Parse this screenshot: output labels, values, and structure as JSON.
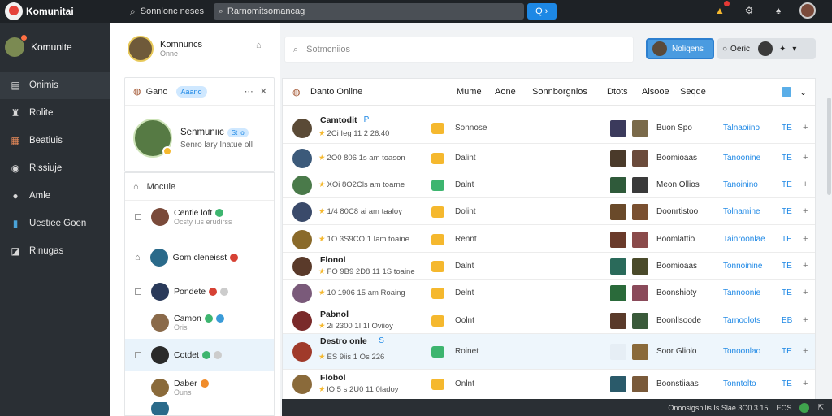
{
  "topbar": {
    "logo_text": "Komunitai",
    "search_label": "Sonnlonc neses",
    "search_value": "Rarnomitsomancag",
    "search_button": "Q ›"
  },
  "sidebar": {
    "brand": "Komunite",
    "items": [
      {
        "label": "Onimis",
        "icon": "grid-icon"
      },
      {
        "label": "Rolite",
        "icon": "people-icon"
      },
      {
        "label": "Beatiuis",
        "icon": "cards-icon"
      },
      {
        "label": "Rissiuje",
        "icon": "target-icon"
      },
      {
        "label": "Amle",
        "icon": "chat-icon"
      },
      {
        "label": "Uestiee Goen",
        "icon": "phone-icon"
      },
      {
        "label": "Rinugas",
        "icon": "square-icon"
      }
    ]
  },
  "left_panel": {
    "user_name": "Komnuncs",
    "user_sub": "Onne",
    "card": {
      "title": "Gano",
      "tag": "Aaano",
      "name": "Senmuniic",
      "pill": "St lo",
      "status": "Senro lary Inatue oll"
    },
    "friends_title": "Mocule",
    "friends": [
      {
        "name": "Centie loft",
        "sub": "Ocsty ius erudirss",
        "color": "#3db56f"
      },
      {
        "name": "Gom cleneisst",
        "sub": "",
        "color": "#d64134"
      },
      {
        "name": "Pondete",
        "sub": "",
        "color": "#d64134"
      },
      {
        "name": "Camon",
        "sub": "Oris",
        "color": "#3a9bd8"
      },
      {
        "name": "Cotdet",
        "sub": "",
        "color": "#3db56f"
      },
      {
        "name": "Daber",
        "sub": "Ouns",
        "color": "#f08c2b"
      }
    ]
  },
  "main": {
    "search_placeholder": "Sotmcniios",
    "blue_button": "Noliqens",
    "grey_button": "Oeric",
    "header": {
      "title": "Danto Online",
      "col1": "Mume",
      "col2": "Aone",
      "col3": "Sonnborgnios",
      "col4": "Dtots",
      "col5": "Alsooe",
      "col6": "Seqqe"
    },
    "rows": [
      {
        "name": "Camtodit",
        "badge": "P",
        "meta": "2Ci Ieg 11 2 26:40",
        "icon_color": "#f5b82e",
        "status": "Sonnose",
        "game": "Buon Spo",
        "link": "Talnaoiino",
        "te": "TE",
        "av": "#5a4a36",
        "th1": "#3b3a5c",
        "th2": "#7a6a4a"
      },
      {
        "name": "",
        "badge": "",
        "meta": "2O0 806 1s am toason",
        "icon_color": "#f5b82e",
        "status": "Dalint",
        "game": "Boomioaas",
        "link": "Tanoonine",
        "te": "TE",
        "av": "#3c5a7a",
        "th1": "#4a3a2a",
        "th2": "#6b4b3b"
      },
      {
        "name": "",
        "badge": "",
        "meta": "XOi 8O2Cls am toarne",
        "icon_color": "#3db56f",
        "status": "Dalnt",
        "game": "Meon Ollios",
        "link": "Tanoinino",
        "te": "TE",
        "av": "#4a7a4a",
        "th1": "#2f5a3a",
        "th2": "#3a3a3a"
      },
      {
        "name": "",
        "badge": "",
        "meta": "1/4 80C8 ai am taaloy",
        "icon_color": "#f5b82e",
        "status": "Dolint",
        "game": "Doonrtistoo",
        "link": "Tolnamine",
        "te": "TE",
        "av": "#3a4a6a",
        "th1": "#6a4a2a",
        "th2": "#7a5030"
      },
      {
        "name": "",
        "badge": "",
        "meta": "1O 3S9CO 1 Iam toaine",
        "icon_color": "#f5b82e",
        "status": "Rennt",
        "game": "Boomlattio",
        "link": "Tainroonlae",
        "te": "TE",
        "av": "#8a6a2a",
        "th1": "#6a3a2a",
        "th2": "#8a4a4a"
      },
      {
        "name": "Flonol",
        "badge": "",
        "meta": "FO 9B9 2D8 11 1S toaine",
        "icon_color": "#f5b82e",
        "status": "Dalnt",
        "game": "Boomioaas",
        "link": "Tonnoinine",
        "te": "TE",
        "av": "#5a3a2a",
        "th1": "#2a6a5a",
        "th2": "#4a4a2a"
      },
      {
        "name": "",
        "badge": "",
        "meta": "10 1906 15 am Roaing",
        "icon_color": "#f5b82e",
        "status": "Delnt",
        "game": "Boonshioty",
        "link": "Tannoonie",
        "te": "TE",
        "av": "#7a5a7a",
        "th1": "#2a6a3a",
        "th2": "#8a4a5a"
      },
      {
        "name": "Pabnol",
        "badge": "",
        "meta": "2i 2300 1I 1I Oviioy",
        "icon_color": "#f5b82e",
        "status": "Oolnt",
        "game": "Boonllsoode",
        "link": "Tarnoolots",
        "te": "EB",
        "av": "#7a2a2a",
        "th1": "#5a3a2a",
        "th2": "#3a5a3a"
      },
      {
        "name": "Destro onle",
        "badge": "S",
        "meta": "ES 9iis 1 Os 226",
        "icon_color": "#3db56f",
        "status": "Roinet",
        "game": "Soor Gliolo",
        "link": "Tonoonlao",
        "te": "TE",
        "av": "#a03a2a",
        "th1": "#e6eef5",
        "th2": "#8a6a3a"
      },
      {
        "name": "Flobol",
        "badge": "",
        "meta": "lO 5 s 2U0 11 0ladoy",
        "icon_color": "#f5b82e",
        "status": "Onlnt",
        "game": "Boonstiiaas",
        "link": "Tonntolto",
        "te": "TE",
        "av": "#8a6a3a",
        "th1": "#2a5a6a",
        "th2": "#7a5a3a"
      }
    ]
  },
  "bottombar": {
    "text": "Onoosigsnilis Is  Slae 3O0 3 15",
    "code": "EOS"
  }
}
